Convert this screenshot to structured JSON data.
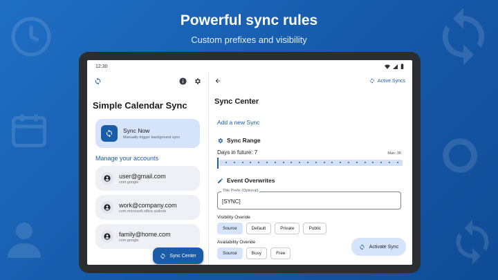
{
  "hero": {
    "title": "Powerful sync rules",
    "subtitle": "Custom prefixes and visibility"
  },
  "status_bar": {
    "time": "12:30"
  },
  "left_pane": {
    "app_title": "Simple Calendar Sync",
    "sync_now": {
      "title": "Sync Now",
      "subtitle": "Manually trigger background sync"
    },
    "manage_label": "Manage your accounts",
    "accounts": [
      {
        "email": "user@gmail.com",
        "type": "com.google"
      },
      {
        "email": "work@company.com",
        "type": "com.microsoft.office.outlook"
      },
      {
        "email": "family@home.com",
        "type": "com.google"
      }
    ],
    "fab_label": "Sync Center"
  },
  "right_pane": {
    "active_syncs": "Active Syncs",
    "title": "Sync Center",
    "add_link": "Add a new Sync",
    "sync_range": {
      "heading": "Sync Range",
      "days_label": "Days in future: 7",
      "max_label": "Max: 30",
      "value": 7,
      "max": 30
    },
    "event_overwrites": {
      "heading": "Event Overwrites",
      "title_prefix_label": "Title Prefix (Optional)",
      "title_prefix_value": "[SYNC]",
      "visibility_label": "Visibility Overide",
      "visibility_options": [
        "Source",
        "Default",
        "Private",
        "Public"
      ],
      "visibility_selected": "Source",
      "availability_label": "Availability Overide",
      "availability_options": [
        "Source",
        "Busy",
        "Free"
      ],
      "availability_selected": "Source"
    },
    "activate_label": "Activate Sync"
  },
  "colors": {
    "background": "#1658a8",
    "accent": "#1a5ca8",
    "container": "#d6e4fb",
    "surface_variant": "#eef0f5"
  }
}
